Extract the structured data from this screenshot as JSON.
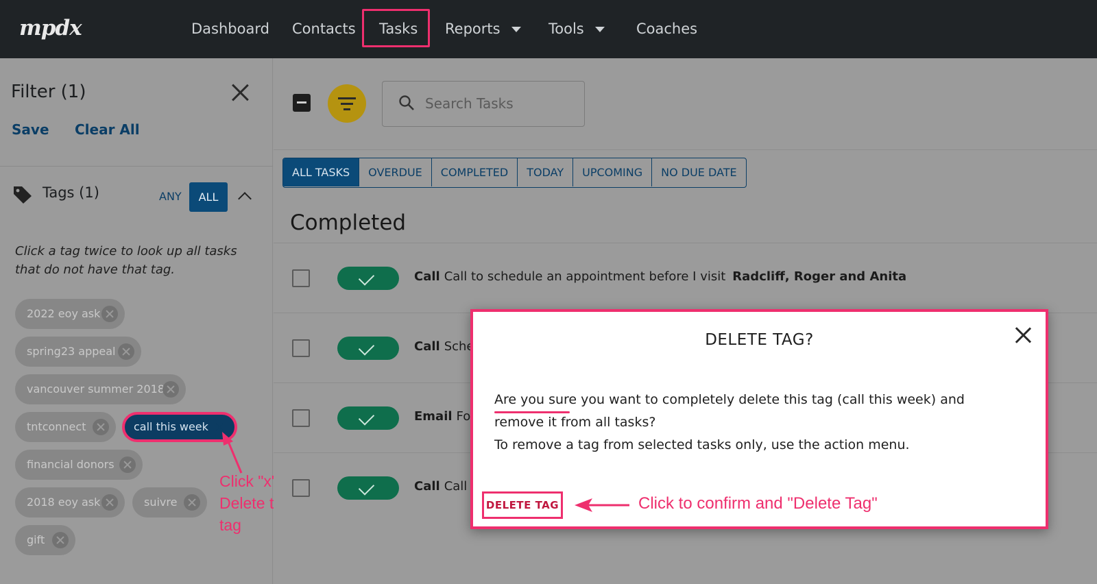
{
  "brand": {
    "logo": "mpdx"
  },
  "nav": {
    "items": [
      {
        "label": "Dashboard"
      },
      {
        "label": "Contacts"
      },
      {
        "label": "Tasks"
      },
      {
        "label": "Reports"
      },
      {
        "label": "Tools"
      },
      {
        "label": "Coaches"
      }
    ]
  },
  "filter": {
    "title": "Filter (1)",
    "save_label": "Save",
    "clear_label": "Clear All",
    "tags_label": "Tags (1)",
    "any_label": "ANY",
    "all_label": "ALL",
    "hint": "Click a tag twice to look up all tasks that do not have that tag.",
    "tags": [
      {
        "label": "2022 eoy ask"
      },
      {
        "label": "spring23 appeal"
      },
      {
        "label": "vancouver summer 2018"
      },
      {
        "label": "tntconnect"
      },
      {
        "label": "call this week",
        "selected": true
      },
      {
        "label": "financial donors"
      },
      {
        "label": "2018 eoy ask"
      },
      {
        "label": "suivre"
      },
      {
        "label": "gift"
      }
    ],
    "annotation": "Click \"x\" to Delete this tag"
  },
  "main": {
    "search_placeholder": "Search Tasks",
    "tabs": [
      {
        "label": "ALL TASKS",
        "active": true
      },
      {
        "label": "OVERDUE"
      },
      {
        "label": "COMPLETED"
      },
      {
        "label": "TODAY"
      },
      {
        "label": "UPCOMING"
      },
      {
        "label": "NO DUE DATE"
      }
    ],
    "section_title": "Completed",
    "tasks": [
      {
        "type": "Call",
        "subject": "Call to schedule an appointment before I visit",
        "contact": "Radcliff, Roger and Anita"
      },
      {
        "type": "Call",
        "subject": "Sche",
        "contact": ""
      },
      {
        "type": "Email",
        "subject": "Fol",
        "contact": ""
      },
      {
        "type": "Call",
        "subject": "Call t",
        "contact": ""
      }
    ]
  },
  "modal": {
    "title": "DELETE TAG?",
    "line1": "Are you sure you want to completely delete this tag (call this week) and remove it from all tasks?",
    "line2": "To remove a tag from selected tasks only, use the action menu.",
    "delete_label": "DELETE TAG",
    "annotation": "Click to confirm and \"Delete Tag\""
  },
  "colors": {
    "accent": "#ee2f6e",
    "primary": "#0b4a78",
    "success": "#0f6e4c",
    "filter_button": "#b59310"
  }
}
